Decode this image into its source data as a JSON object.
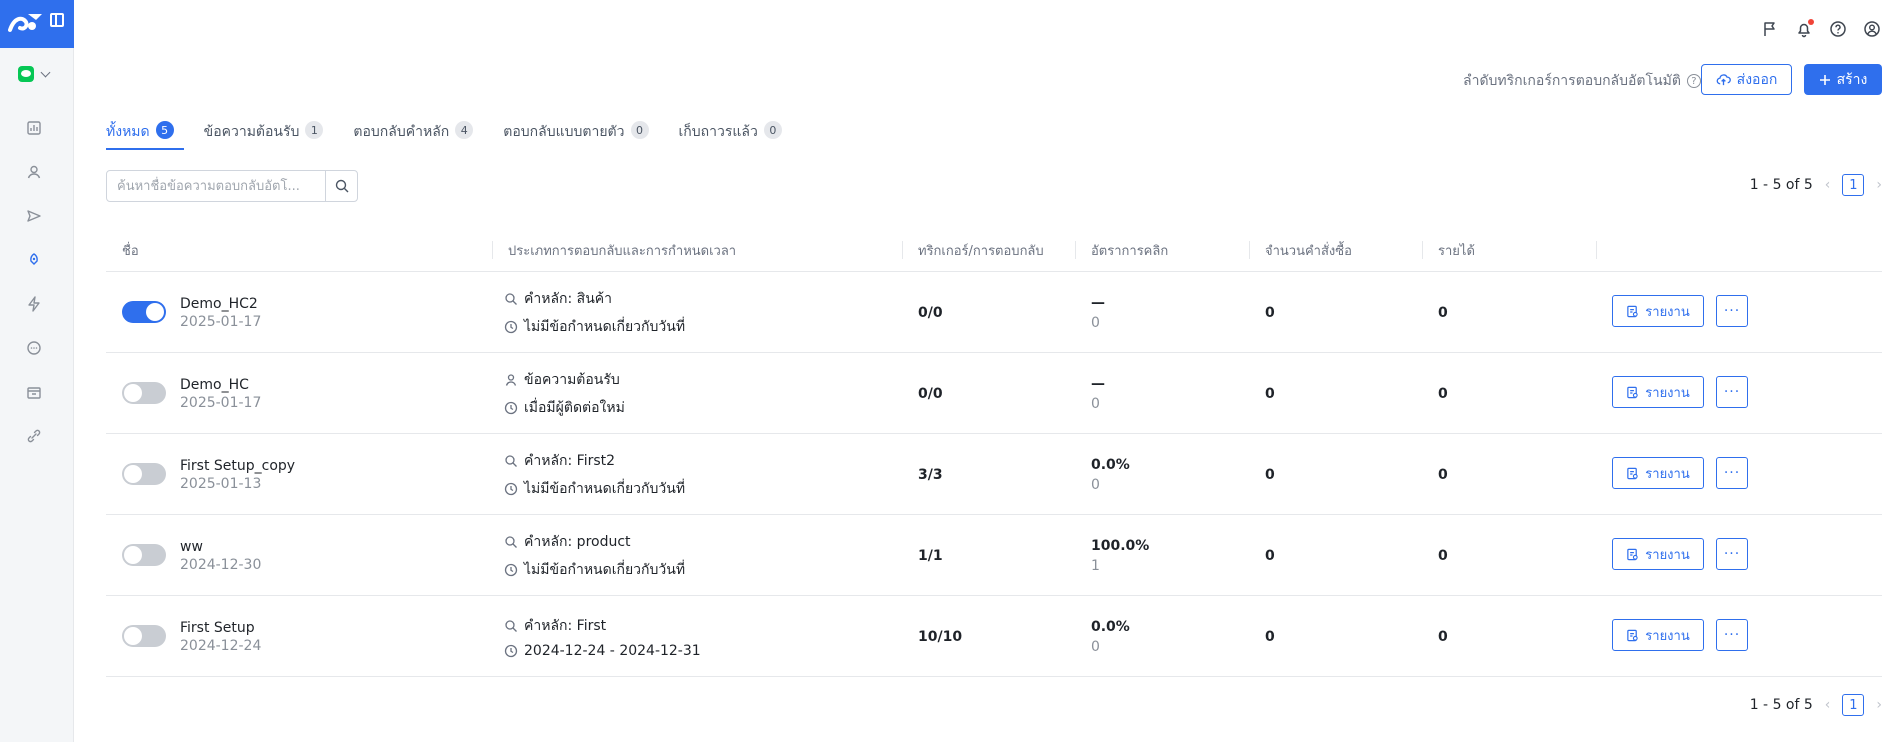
{
  "header": {
    "order_link": "ลำดับทริกเกอร์การตอบกลับอัตโนมัติ",
    "export_label": "ส่งออก",
    "create_label": "สร้าง"
  },
  "tabs": [
    {
      "label": "ทั้งหมด",
      "count": "5"
    },
    {
      "label": "ข้อความต้อนรับ",
      "count": "1"
    },
    {
      "label": "ตอบกลับคำหลัก",
      "count": "4"
    },
    {
      "label": "ตอบกลับแบบตายตัว",
      "count": "0"
    },
    {
      "label": "เก็บถาวรแล้ว",
      "count": "0"
    }
  ],
  "search": {
    "placeholder": "ค้นหาชื่อข้อความตอบกลับอัตโ..."
  },
  "pagination": {
    "summary": "1 - 5 of 5",
    "page": "1"
  },
  "columns": {
    "name": "ชื่อ",
    "type": "ประเภทการตอบกลับและการกำหนดเวลา",
    "triggers": "ทริกเกอร์/การตอบกลับ",
    "ctr": "อัตราการคลิก",
    "orders": "จำนวนคำสั่งซื้อ",
    "revenue": "รายได้"
  },
  "row_buttons": {
    "report": "รายงาน",
    "more": "···"
  },
  "rows": [
    {
      "enabled": true,
      "name": "Demo_HC2",
      "date": "2025-01-17",
      "type_icon": "search-icon",
      "type": "คำหลัก: สินค้า",
      "schedule": "ไม่มีข้อกำหนดเกี่ยวกับวันที่",
      "triggers": "0/0",
      "ctr": "—",
      "ctr_sub": "0",
      "orders": "0",
      "revenue": "0"
    },
    {
      "enabled": false,
      "name": "Demo_HC",
      "date": "2025-01-17",
      "type_icon": "user-icon",
      "type": "ข้อความต้อนรับ",
      "schedule": "เมื่อมีผู้ติดต่อใหม่",
      "triggers": "0/0",
      "ctr": "—",
      "ctr_sub": "0",
      "orders": "0",
      "revenue": "0"
    },
    {
      "enabled": false,
      "name": "First Setup_copy",
      "date": "2025-01-13",
      "type_icon": "search-icon",
      "type": "คำหลัก: First2",
      "schedule": "ไม่มีข้อกำหนดเกี่ยวกับวันที่",
      "triggers": "3/3",
      "ctr": "0.0%",
      "ctr_sub": "0",
      "orders": "0",
      "revenue": "0"
    },
    {
      "enabled": false,
      "name": "ww",
      "date": "2024-12-30",
      "type_icon": "search-icon",
      "type": "คำหลัก: product",
      "schedule": "ไม่มีข้อกำหนดเกี่ยวกับวันที่",
      "triggers": "1/1",
      "ctr": "100.0%",
      "ctr_sub": "1",
      "orders": "0",
      "revenue": "0"
    },
    {
      "enabled": false,
      "name": "First Setup",
      "date": "2024-12-24",
      "type_icon": "search-icon",
      "type": "คำหลัก: First",
      "schedule": "2024-12-24 - 2024-12-31",
      "triggers": "10/10",
      "ctr": "0.0%",
      "ctr_sub": "0",
      "orders": "0",
      "revenue": "0"
    }
  ],
  "colors": {
    "accent": "#2f6fed",
    "notification_dot": "#f04438",
    "line_green": "#06c755"
  }
}
